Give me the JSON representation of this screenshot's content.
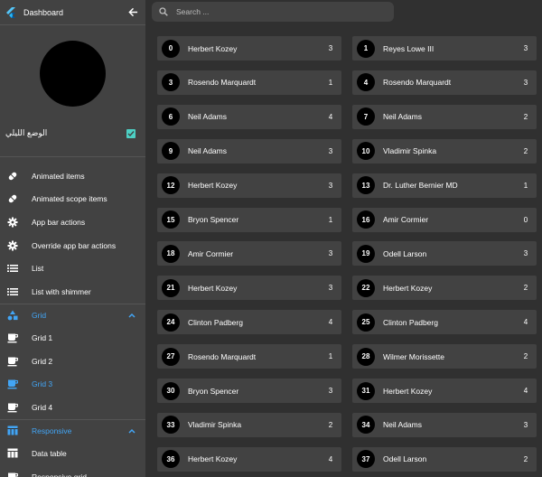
{
  "app": {
    "title": "Dashboard"
  },
  "sidebar": {
    "dark_mode_label": "الوضع الليلي",
    "dark_mode_checked": true,
    "items": [
      {
        "label": "Animated items",
        "icon": "pill-icon"
      },
      {
        "label": "Animated scope items",
        "icon": "pill-icon"
      },
      {
        "label": "App bar actions",
        "icon": "gear-icon"
      },
      {
        "label": "Override app bar actions",
        "icon": "gear-icon"
      },
      {
        "label": "List",
        "icon": "list-icon"
      },
      {
        "label": "List with shimmer",
        "icon": "list-icon"
      }
    ],
    "grid_group": {
      "label": "Grid",
      "icon": "shapes-icon",
      "expanded": true
    },
    "grid_items": [
      {
        "label": "Grid 1",
        "icon": "coffee-icon",
        "active": false
      },
      {
        "label": "Grid 2",
        "icon": "coffee-icon",
        "active": false
      },
      {
        "label": "Grid 3",
        "icon": "coffee-icon",
        "active": true
      },
      {
        "label": "Grid 4",
        "icon": "coffee-icon",
        "active": false
      }
    ],
    "responsive_group": {
      "label": "Responsive",
      "icon": "table-icon",
      "expanded": true
    },
    "responsive_items": [
      {
        "label": "Data table",
        "icon": "table-icon"
      },
      {
        "label": "Responsive grid",
        "icon": "coffee-icon"
      }
    ]
  },
  "search": {
    "placeholder": "Search ..."
  },
  "cards": [
    {
      "id": "0",
      "name": "Herbert Kozey",
      "count": "3"
    },
    {
      "id": "1",
      "name": "Reyes Lowe III",
      "count": "3"
    },
    {
      "id": "3",
      "name": "Rosendo Marquardt",
      "count": "1"
    },
    {
      "id": "4",
      "name": "Rosendo Marquardt",
      "count": "3"
    },
    {
      "id": "6",
      "name": "Neil Adams",
      "count": "4"
    },
    {
      "id": "7",
      "name": "Neil Adams",
      "count": "2"
    },
    {
      "id": "9",
      "name": "Neil Adams",
      "count": "3"
    },
    {
      "id": "10",
      "name": "Vladimir Spinka",
      "count": "2"
    },
    {
      "id": "12",
      "name": "Herbert Kozey",
      "count": "3"
    },
    {
      "id": "13",
      "name": "Dr. Luther Bernier MD",
      "count": "1"
    },
    {
      "id": "15",
      "name": "Bryon Spencer",
      "count": "1"
    },
    {
      "id": "16",
      "name": "Amir Cormier",
      "count": "0"
    },
    {
      "id": "18",
      "name": "Amir Cormier",
      "count": "3"
    },
    {
      "id": "19",
      "name": "Odell Larson",
      "count": "3"
    },
    {
      "id": "21",
      "name": "Herbert Kozey",
      "count": "3"
    },
    {
      "id": "22",
      "name": "Herbert Kozey",
      "count": "2"
    },
    {
      "id": "24",
      "name": "Clinton Padberg",
      "count": "4"
    },
    {
      "id": "25",
      "name": "Clinton Padberg",
      "count": "4"
    },
    {
      "id": "27",
      "name": "Rosendo Marquardt",
      "count": "1"
    },
    {
      "id": "28",
      "name": "Wilmer Morissette",
      "count": "2"
    },
    {
      "id": "30",
      "name": "Bryon Spencer",
      "count": "3"
    },
    {
      "id": "31",
      "name": "Herbert Kozey",
      "count": "4"
    },
    {
      "id": "33",
      "name": "Vladimir Spinka",
      "count": "2"
    },
    {
      "id": "34",
      "name": "Neil Adams",
      "count": "3"
    },
    {
      "id": "36",
      "name": "Herbert Kozey",
      "count": "4"
    },
    {
      "id": "37",
      "name": "Odell Larson",
      "count": "2"
    }
  ],
  "colors": {
    "accent": "#42a5f5",
    "checkbox": "#4dd0c4",
    "sidebar": "#424242",
    "background": "#303030"
  }
}
